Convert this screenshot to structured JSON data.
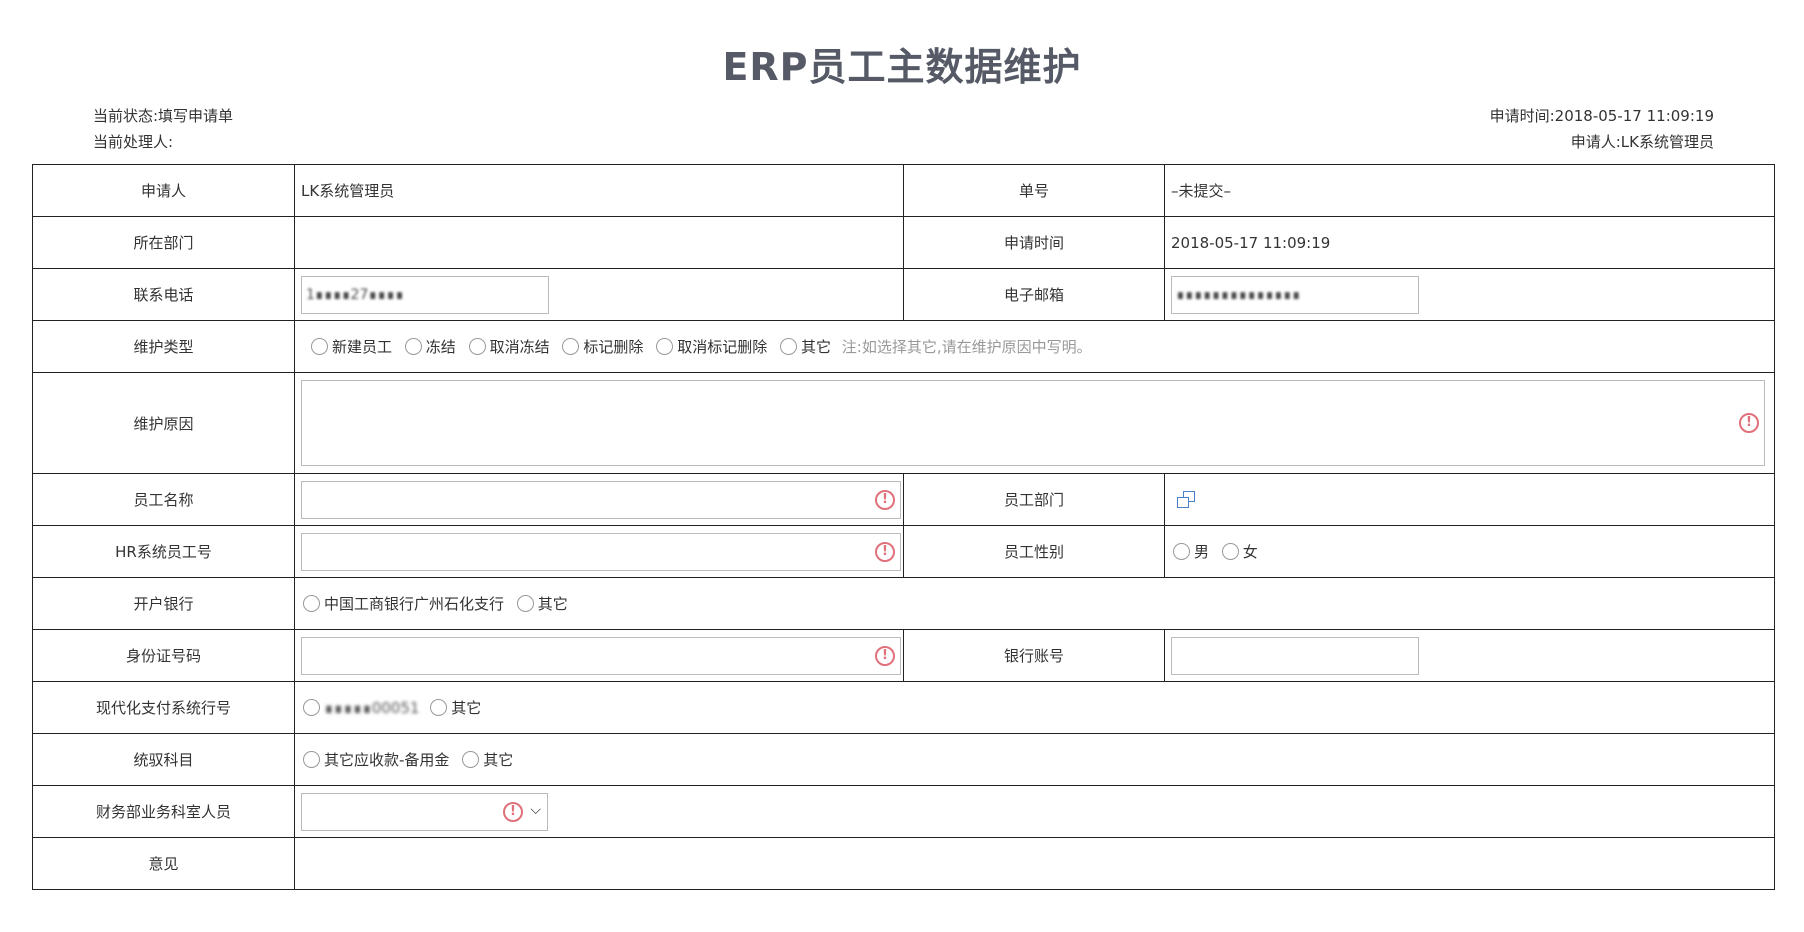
{
  "page": {
    "title": "ERP员工主数据维护",
    "status": "当前状态:填写申请单",
    "handler": "当前处理人:",
    "apply_time": "申请时间:2018-05-17 11:09:19",
    "applicant": "申请人:LK系统管理员"
  },
  "form": {
    "applicant_label": "申请人",
    "applicant_value": "LK系统管理员",
    "order_no_label": "单号",
    "order_no_value": "–未提交–",
    "dept_label": "所在部门",
    "dept_value": "",
    "apply_time_label": "申请时间",
    "apply_time_value": "2018-05-17 11:09:19",
    "phone_label": "联系电话",
    "phone_value": "1∎∎∎∎27∎∎∎∎",
    "email_label": "电子邮箱",
    "email_value": "∎∎∎∎∎∎∎∎∎∎∎∎∎∎",
    "maint_type_label": "维护类型",
    "maint_type_options": [
      "新建员工",
      "冻结",
      "取消冻结",
      "标记删除",
      "取消标记删除",
      "其它"
    ],
    "maint_type_note": "注:如选择其它,请在维护原因中写明。",
    "reason_label": "维护原因",
    "emp_name_label": "员工名称",
    "emp_dept_label": "员工部门",
    "hr_no_label": "HR系统员工号",
    "gender_label": "员工性别",
    "gender_options": [
      "男",
      "女"
    ],
    "bank_label": "开户银行",
    "bank_options": [
      "中国工商银行广州石化支行",
      "其它"
    ],
    "id_no_label": "身份证号码",
    "bank_account_label": "银行账号",
    "pay_sys_label": "现代化支付系统行号",
    "pay_sys_options": [
      "∎∎∎∎∎00051",
      "其它"
    ],
    "subject_label": "统驭科目",
    "subject_options": [
      "其它应收款-备用金",
      "其它"
    ],
    "finance_staff_label": "财务部业务科室人员",
    "opinion_label": "意见"
  }
}
